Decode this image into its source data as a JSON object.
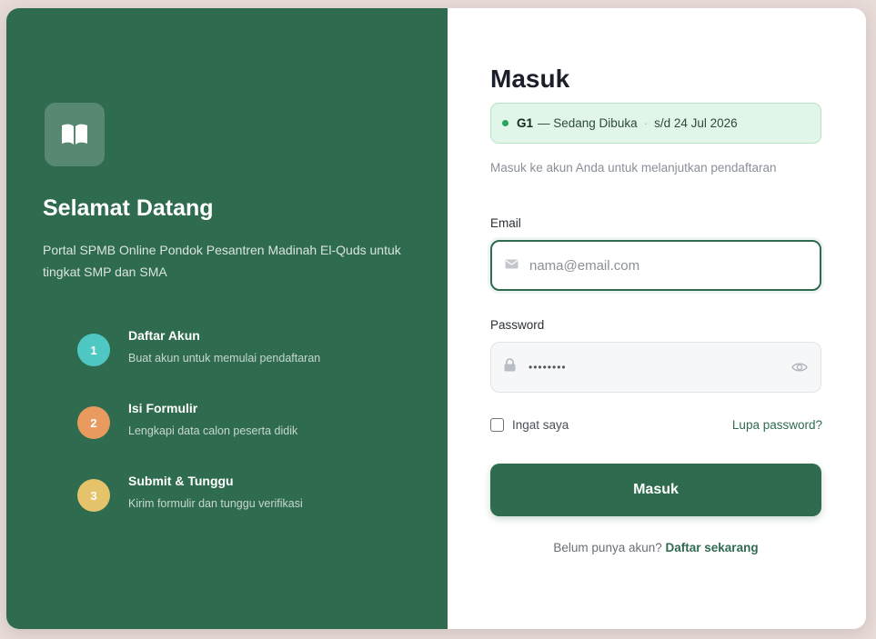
{
  "left_panel": {
    "brand_icon": "book-icon",
    "title": "Selamat Datang",
    "description": "Portal SPMB Online Pondok Pesantren Madinah El-Quds untuk tingkat SMP dan SMA",
    "steps": [
      {
        "number": "1",
        "title": "Daftar Akun",
        "description": "Buat akun untuk memulai pendaftaran",
        "color": "#4fc7c3"
      },
      {
        "number": "2",
        "title": "Isi Formulir",
        "description": "Lengkapi data calon peserta didik",
        "color": "#e89a5f"
      },
      {
        "number": "3",
        "title": "Submit & Tunggu",
        "description": "Kirim formulir dan tunggu verifikasi",
        "color": "#e5c36a"
      }
    ],
    "background_color": "#2f6b4f"
  },
  "login": {
    "title": "Masuk",
    "status": {
      "wave": "G1",
      "state": "— Sedang Dibuka",
      "separator": "·",
      "deadline": "s/d 24 Jul 2026",
      "dot_color": "#27a55a"
    },
    "subtitle": "Masuk ke akun Anda untuk melanjutkan pendaftaran",
    "email": {
      "label": "Email",
      "placeholder": "nama@email.com",
      "value": "",
      "icon": "mail-icon"
    },
    "password": {
      "label": "Password",
      "masked_value": "••••••••",
      "icon": "lock-icon",
      "toggle_icon": "eye-icon"
    },
    "remember_label": "Ingat saya",
    "remember_checked": false,
    "forgot_label": "Lupa password?",
    "submit_label": "Masuk",
    "register_prompt": "Belum punya akun?",
    "register_link": "Daftar sekarang",
    "accent_color": "#2f6b4f"
  }
}
